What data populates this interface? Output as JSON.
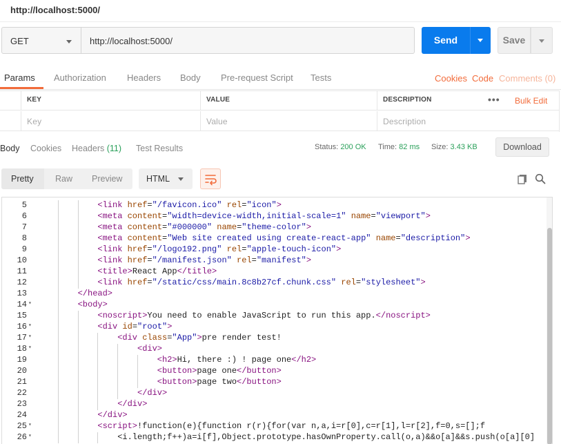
{
  "window": {
    "title": "http://localhost:5000/"
  },
  "request": {
    "method": "GET",
    "url": "http://localhost:5000/",
    "send_label": "Send",
    "save_label": "Save"
  },
  "request_tabs": {
    "items": [
      "Params",
      "Authorization",
      "Headers",
      "Body",
      "Pre-request Script",
      "Tests"
    ],
    "active": "Params",
    "right": {
      "cookies": "Cookies",
      "code": "Code",
      "comments": "Comments (0)"
    }
  },
  "params_table": {
    "headers": [
      "KEY",
      "VALUE",
      "DESCRIPTION"
    ],
    "placeholders": [
      "Key",
      "Value",
      "Description"
    ],
    "more": "•••",
    "bulk_edit": "Bulk Edit"
  },
  "response_tabs": {
    "items": [
      "Body",
      "Cookies",
      "Headers",
      "Test Results"
    ],
    "headers_count": "(11)",
    "active": "Body",
    "status_label": "Status:",
    "status_value": "200 OK",
    "time_label": "Time:",
    "time_value": "82 ms",
    "size_label": "Size:",
    "size_value": "3.43 KB",
    "download_label": "Download"
  },
  "view_bar": {
    "modes": [
      "Pretty",
      "Raw",
      "Preview"
    ],
    "active_mode": "Pretty",
    "format": "HTML",
    "icons": [
      "wrap-lines-icon",
      "copy-icon",
      "search-icon"
    ]
  },
  "colors": {
    "accent": "#f26b3a",
    "send": "#097bed",
    "status_ok": "#2aa05a",
    "tag": "#881280",
    "attr": "#994500",
    "value": "#1a1aa6"
  },
  "code": {
    "lines": [
      {
        "n": "5",
        "fold": false,
        "indent": 3,
        "parts": [
          [
            "tg",
            "<link "
          ],
          [
            "at",
            "href"
          ],
          [
            "tx",
            "="
          ],
          [
            "av",
            "\"/favicon.ico\""
          ],
          [
            "tx",
            " "
          ],
          [
            "at",
            "rel"
          ],
          [
            "tx",
            "="
          ],
          [
            "av",
            "\"icon\""
          ],
          [
            "tg",
            ">"
          ]
        ]
      },
      {
        "n": "6",
        "fold": false,
        "indent": 3,
        "parts": [
          [
            "tg",
            "<meta "
          ],
          [
            "at",
            "content"
          ],
          [
            "tx",
            "="
          ],
          [
            "av",
            "\"width=device-width,initial-scale=1\""
          ],
          [
            "tx",
            " "
          ],
          [
            "at",
            "name"
          ],
          [
            "tx",
            "="
          ],
          [
            "av",
            "\"viewport\""
          ],
          [
            "tg",
            ">"
          ]
        ]
      },
      {
        "n": "7",
        "fold": false,
        "indent": 3,
        "parts": [
          [
            "tg",
            "<meta "
          ],
          [
            "at",
            "content"
          ],
          [
            "tx",
            "="
          ],
          [
            "av",
            "\"#000000\""
          ],
          [
            "tx",
            " "
          ],
          [
            "at",
            "name"
          ],
          [
            "tx",
            "="
          ],
          [
            "av",
            "\"theme-color\""
          ],
          [
            "tg",
            ">"
          ]
        ]
      },
      {
        "n": "8",
        "fold": false,
        "indent": 3,
        "parts": [
          [
            "tg",
            "<meta "
          ],
          [
            "at",
            "content"
          ],
          [
            "tx",
            "="
          ],
          [
            "av",
            "\"Web site created using create-react-app\""
          ],
          [
            "tx",
            " "
          ],
          [
            "at",
            "name"
          ],
          [
            "tx",
            "="
          ],
          [
            "av",
            "\"description\""
          ],
          [
            "tg",
            ">"
          ]
        ]
      },
      {
        "n": "9",
        "fold": false,
        "indent": 3,
        "parts": [
          [
            "tg",
            "<link "
          ],
          [
            "at",
            "href"
          ],
          [
            "tx",
            "="
          ],
          [
            "av",
            "\"/logo192.png\""
          ],
          [
            "tx",
            " "
          ],
          [
            "at",
            "rel"
          ],
          [
            "tx",
            "="
          ],
          [
            "av",
            "\"apple-touch-icon\""
          ],
          [
            "tg",
            ">"
          ]
        ]
      },
      {
        "n": "10",
        "fold": false,
        "indent": 3,
        "parts": [
          [
            "tg",
            "<link "
          ],
          [
            "at",
            "href"
          ],
          [
            "tx",
            "="
          ],
          [
            "av",
            "\"/manifest.json\""
          ],
          [
            "tx",
            " "
          ],
          [
            "at",
            "rel"
          ],
          [
            "tx",
            "="
          ],
          [
            "av",
            "\"manifest\""
          ],
          [
            "tg",
            ">"
          ]
        ]
      },
      {
        "n": "11",
        "fold": false,
        "indent": 3,
        "parts": [
          [
            "tg",
            "<title>"
          ],
          [
            "tx",
            "React App"
          ],
          [
            "tg",
            "</title>"
          ]
        ]
      },
      {
        "n": "12",
        "fold": false,
        "indent": 3,
        "parts": [
          [
            "tg",
            "<link "
          ],
          [
            "at",
            "href"
          ],
          [
            "tx",
            "="
          ],
          [
            "av",
            "\"/static/css/main.8c8b27cf.chunk.css\""
          ],
          [
            "tx",
            " "
          ],
          [
            "at",
            "rel"
          ],
          [
            "tx",
            "="
          ],
          [
            "av",
            "\"stylesheet\""
          ],
          [
            "tg",
            ">"
          ]
        ]
      },
      {
        "n": "13",
        "fold": false,
        "indent": 2,
        "parts": [
          [
            "tg",
            "</head>"
          ]
        ]
      },
      {
        "n": "14",
        "fold": true,
        "indent": 2,
        "parts": [
          [
            "tg",
            "<body>"
          ]
        ]
      },
      {
        "n": "15",
        "fold": false,
        "indent": 3,
        "parts": [
          [
            "tg",
            "<noscript>"
          ],
          [
            "tx",
            "You need to enable JavaScript to run this app."
          ],
          [
            "tg",
            "</noscript>"
          ]
        ]
      },
      {
        "n": "16",
        "fold": true,
        "indent": 3,
        "parts": [
          [
            "tg",
            "<div "
          ],
          [
            "at",
            "id"
          ],
          [
            "tx",
            "="
          ],
          [
            "av",
            "\"root\""
          ],
          [
            "tg",
            ">"
          ]
        ]
      },
      {
        "n": "17",
        "fold": true,
        "indent": 4,
        "parts": [
          [
            "tg",
            "<div "
          ],
          [
            "at",
            "class"
          ],
          [
            "tx",
            "="
          ],
          [
            "av",
            "\"App\""
          ],
          [
            "tg",
            ">"
          ],
          [
            "tx",
            "pre render test!"
          ]
        ]
      },
      {
        "n": "18",
        "fold": true,
        "indent": 5,
        "parts": [
          [
            "tg",
            "<div>"
          ]
        ]
      },
      {
        "n": "19",
        "fold": false,
        "indent": 6,
        "parts": [
          [
            "tg",
            "<h2>"
          ],
          [
            "tx",
            "Hi, there :) ! page one"
          ],
          [
            "tg",
            "</h2>"
          ]
        ]
      },
      {
        "n": "20",
        "fold": false,
        "indent": 6,
        "parts": [
          [
            "tg",
            "<button>"
          ],
          [
            "tx",
            "page one"
          ],
          [
            "tg",
            "</button>"
          ]
        ]
      },
      {
        "n": "21",
        "fold": false,
        "indent": 6,
        "parts": [
          [
            "tg",
            "<button>"
          ],
          [
            "tx",
            "page two"
          ],
          [
            "tg",
            "</button>"
          ]
        ]
      },
      {
        "n": "22",
        "fold": false,
        "indent": 5,
        "parts": [
          [
            "tg",
            "</div>"
          ]
        ]
      },
      {
        "n": "23",
        "fold": false,
        "indent": 4,
        "parts": [
          [
            "tg",
            "</div>"
          ]
        ]
      },
      {
        "n": "24",
        "fold": false,
        "indent": 3,
        "parts": [
          [
            "tg",
            "</div>"
          ]
        ]
      },
      {
        "n": "25",
        "fold": true,
        "indent": 3,
        "parts": [
          [
            "tg",
            "<script>"
          ],
          [
            "tx",
            "!function(e){function r(r){for(var n,a,i=r[0],c=r[1],l=r[2],f=0,s=[];f"
          ]
        ]
      },
      {
        "n": "26",
        "fold": true,
        "indent": 4,
        "parts": [
          [
            "tx",
            "<i.length;f++)a=i[f],Object.prototype.hasOwnProperty.call(o,a)&&o[a]&&s.push(o[a][0]"
          ]
        ]
      }
    ]
  }
}
